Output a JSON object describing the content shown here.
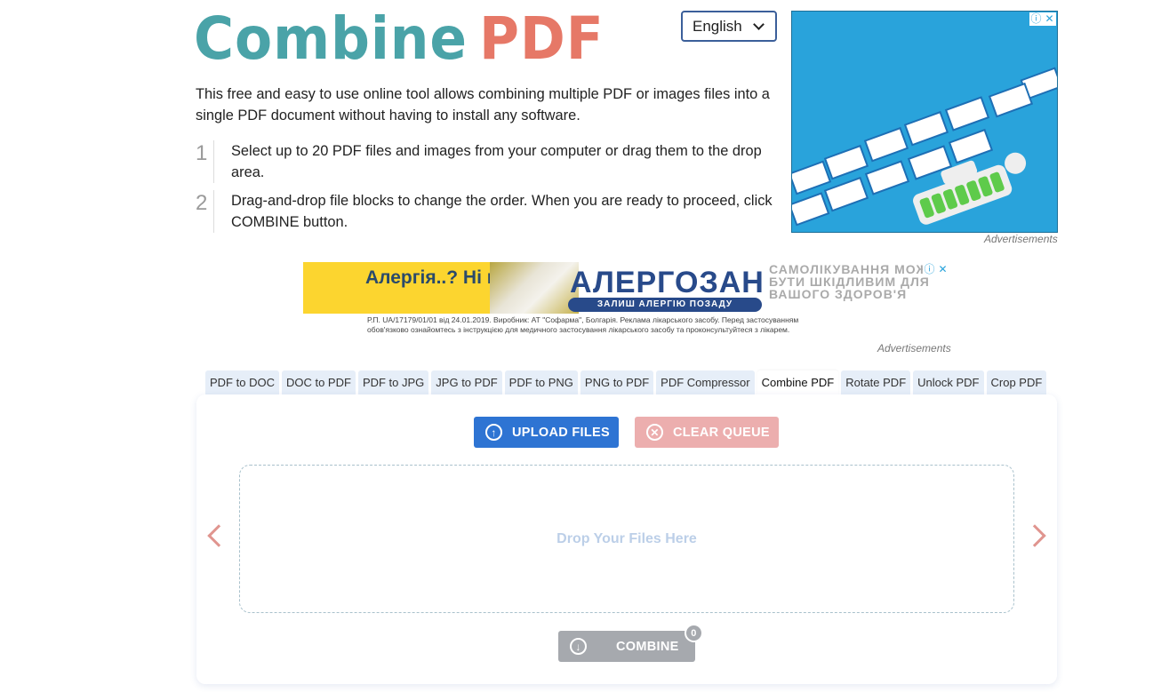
{
  "header": {
    "logo_part1": "Combine",
    "logo_part2": "PDF",
    "language_selected": "English",
    "intro": "This free and easy to use online tool allows combining multiple PDF or images files into a single PDF document without having to install any software.",
    "steps": [
      {
        "num": "1",
        "text": "Select up to 20 PDF files and images from your computer or drag them to the drop area."
      },
      {
        "num": "2",
        "text": "Drag-and-drop file blocks to change the order. When you are ready to proceed, click COMBINE button."
      }
    ]
  },
  "ads": {
    "label": "Advertisements",
    "info_icon": "ⓘ",
    "close_icon": "✕",
    "banner": {
      "headline": "Алергія..? Ні не чув",
      "brand": "АЛЕРГОЗАН",
      "slogan": "ЗАЛИШ АЛЕРГІЮ ПОЗАДУ",
      "warning": "САМОЛІКУВАННЯ МОЖЕ БУТИ ШКІДЛИВИМ ДЛЯ ВАШОГО ЗДОРОВ'Я",
      "fine_print_1": "Р.П. UA/17179/01/01 від 24.01.2019. Виробник: АТ \"Софарма\", Болгарія. Реклама лікарського засобу. Перед застосуванням",
      "fine_print_2": "обов'язково ознайомтесь з інструкцією для медичного застосування лікарського засобу та проконсультуйтеся з лікарем."
    }
  },
  "tabs": [
    {
      "label": "PDF to DOC",
      "active": false
    },
    {
      "label": "DOC to PDF",
      "active": false
    },
    {
      "label": "PDF to JPG",
      "active": false
    },
    {
      "label": "JPG to PDF",
      "active": false
    },
    {
      "label": "PDF to PNG",
      "active": false
    },
    {
      "label": "PNG to PDF",
      "active": false
    },
    {
      "label": "PDF Compressor",
      "active": false
    },
    {
      "label": "Combine PDF",
      "active": true
    },
    {
      "label": "Rotate PDF",
      "active": false
    },
    {
      "label": "Unlock PDF",
      "active": false
    },
    {
      "label": "Crop PDF",
      "active": false
    }
  ],
  "panel": {
    "upload_label": "UPLOAD FILES",
    "clear_label": "CLEAR QUEUE",
    "drop_text": "Drop Your Files Here",
    "combine_label": "COMBINE",
    "file_count": "0",
    "upload_icon": "↑",
    "clear_icon": "✕",
    "combine_icon": "↓"
  },
  "colors": {
    "logo_teal": "#4aa3a8",
    "logo_coral": "#e67867",
    "upload_blue": "#2e74d3",
    "clear_pink": "#ecaeae",
    "combine_gray": "#a6a9ae",
    "arrow_coral": "#e0958f"
  }
}
